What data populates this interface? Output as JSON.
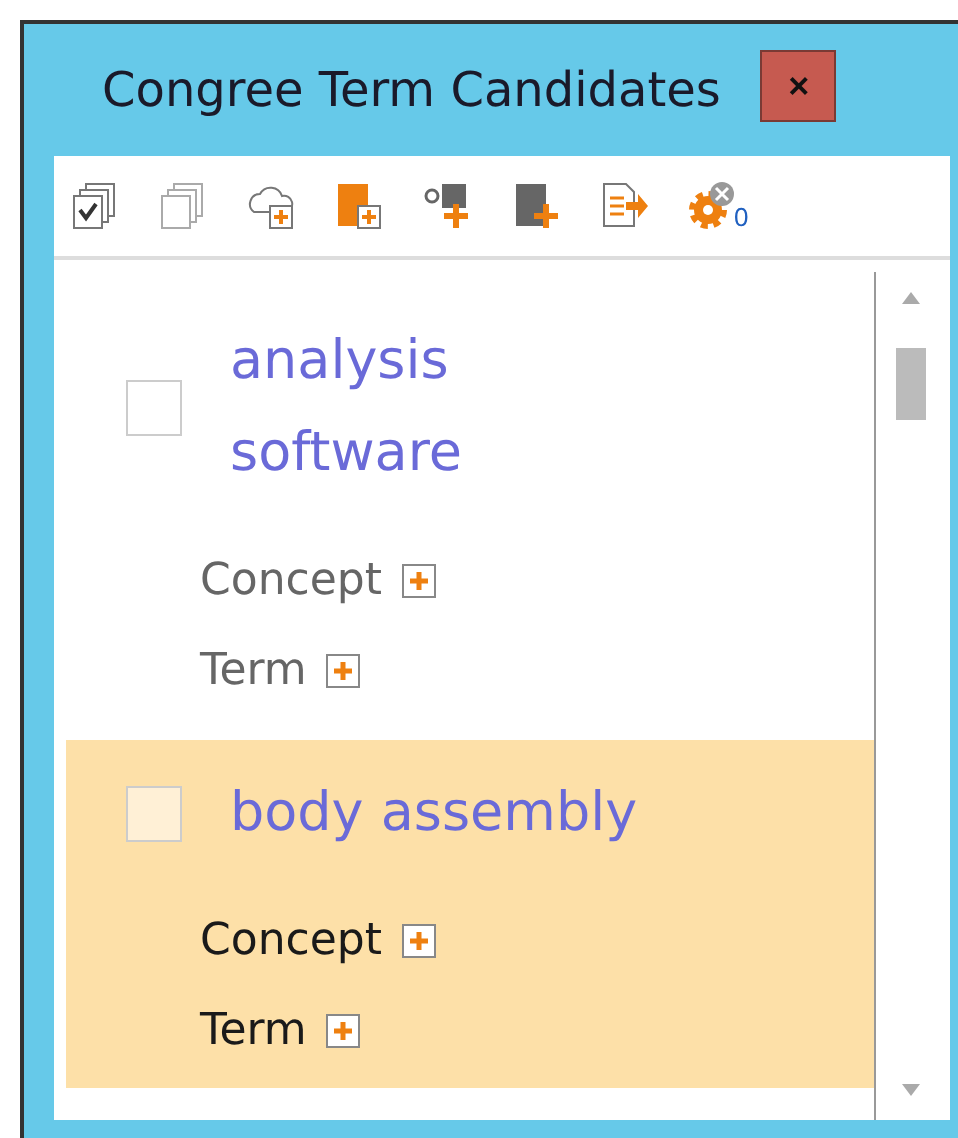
{
  "window": {
    "title": "Congree Term Candidates",
    "close": "×"
  },
  "toolbar": {
    "badge": "0"
  },
  "candidates": [
    {
      "term": "analysis software",
      "selected": false,
      "checked": false,
      "links": [
        "Concept",
        "Term"
      ]
    },
    {
      "term": "body assembly",
      "selected": true,
      "checked": false,
      "links": [
        "Concept",
        "Term"
      ]
    }
  ]
}
